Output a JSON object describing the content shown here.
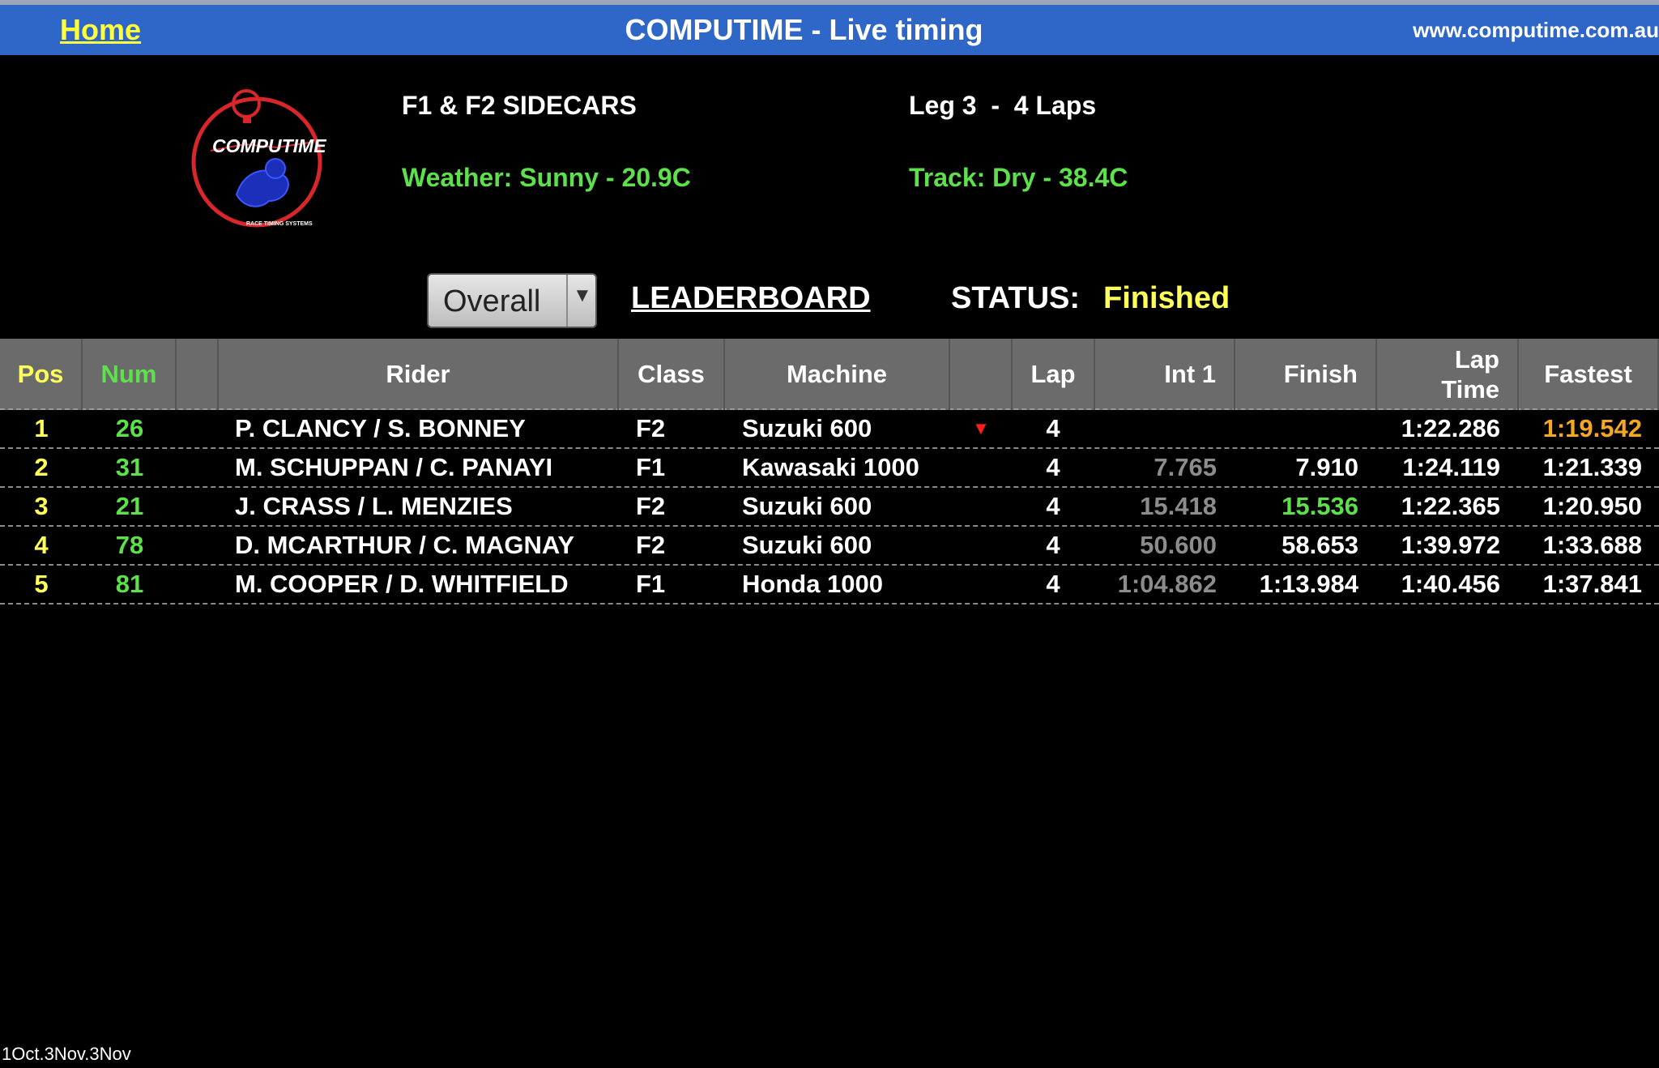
{
  "header": {
    "home": "Home",
    "title": "COMPUTIME - Live timing",
    "url": "www.computime.com.au"
  },
  "logo": {
    "text": "COMPUTIME",
    "subtext": "RACE TIMING SYSTEMS"
  },
  "event": {
    "name": "F1 & F2 SIDECARS",
    "leg": "Leg 3  -  4 Laps",
    "weather": "Weather: Sunny - 20.9C",
    "track": "Track: Dry - 38.4C"
  },
  "controls": {
    "view_select": "Overall",
    "leaderboard": "LEADERBOARD",
    "status_label": "STATUS:",
    "status_value": "Finished"
  },
  "table": {
    "columns": [
      "Pos",
      "Num",
      "",
      "Rider",
      "Class",
      "Machine",
      "",
      "Lap",
      "Int 1",
      "Finish",
      "Lap Time",
      "Fastest"
    ],
    "rows": [
      {
        "pos": "1",
        "num": "26",
        "rider": "P. CLANCY / S. BONNEY",
        "class": "F2",
        "machine": "Suzuki 600",
        "flag": "▼",
        "lap": "4",
        "int1": "",
        "finish": "",
        "laptime": "1:22.286",
        "fastest": "1:19.542"
      },
      {
        "pos": "2",
        "num": "31",
        "rider": "M. SCHUPPAN / C. PANAYI",
        "class": "F1",
        "machine": "Kawasaki 1000",
        "flag": "",
        "lap": "4",
        "int1": "7.765",
        "finish": "7.910",
        "laptime": "1:24.119",
        "fastest": "1:21.339"
      },
      {
        "pos": "3",
        "num": "21",
        "rider": "J. CRASS / L. MENZIES",
        "class": "F2",
        "machine": "Suzuki 600",
        "flag": "",
        "lap": "4",
        "int1": "15.418",
        "finish": "15.536",
        "laptime": "1:22.365",
        "fastest": "1:20.950"
      },
      {
        "pos": "4",
        "num": "78",
        "rider": "D. MCARTHUR / C. MAGNAY",
        "class": "F2",
        "machine": "Suzuki 600",
        "flag": "",
        "lap": "4",
        "int1": "50.600",
        "finish": "58.653",
        "laptime": "1:39.972",
        "fastest": "1:33.688"
      },
      {
        "pos": "5",
        "num": "81",
        "rider": "M. COOPER / D. WHITFIELD",
        "class": "F1",
        "machine": "Honda 1000",
        "flag": "",
        "lap": "4",
        "int1": "1:04.862",
        "finish": "1:13.984",
        "laptime": "1:40.456",
        "fastest": "1:37.841"
      }
    ]
  },
  "footer": "1Oct.3Nov.3Nov",
  "colors": {
    "header_bg": "#2f67c8",
    "accent_yellow": "#ffff5a",
    "accent_green": "#5de04c",
    "fastest_best": "#f5a623",
    "flag_red": "#ff1e1e"
  }
}
